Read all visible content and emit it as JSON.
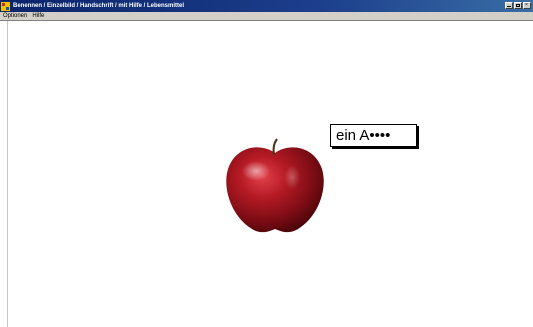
{
  "window": {
    "title": "Benennen / Einzelbild / Handschrift / mit Hilfe / Lebensmittel"
  },
  "menu": {
    "items": [
      {
        "label": "Optionen"
      },
      {
        "label": "Hilfe"
      }
    ]
  },
  "content": {
    "image_icon": "apple",
    "answer_text": "ein A••••"
  },
  "colors": {
    "titlebar": "#0a246a",
    "menubar": "#d4d0c8",
    "apple_red": "#a0141c"
  }
}
